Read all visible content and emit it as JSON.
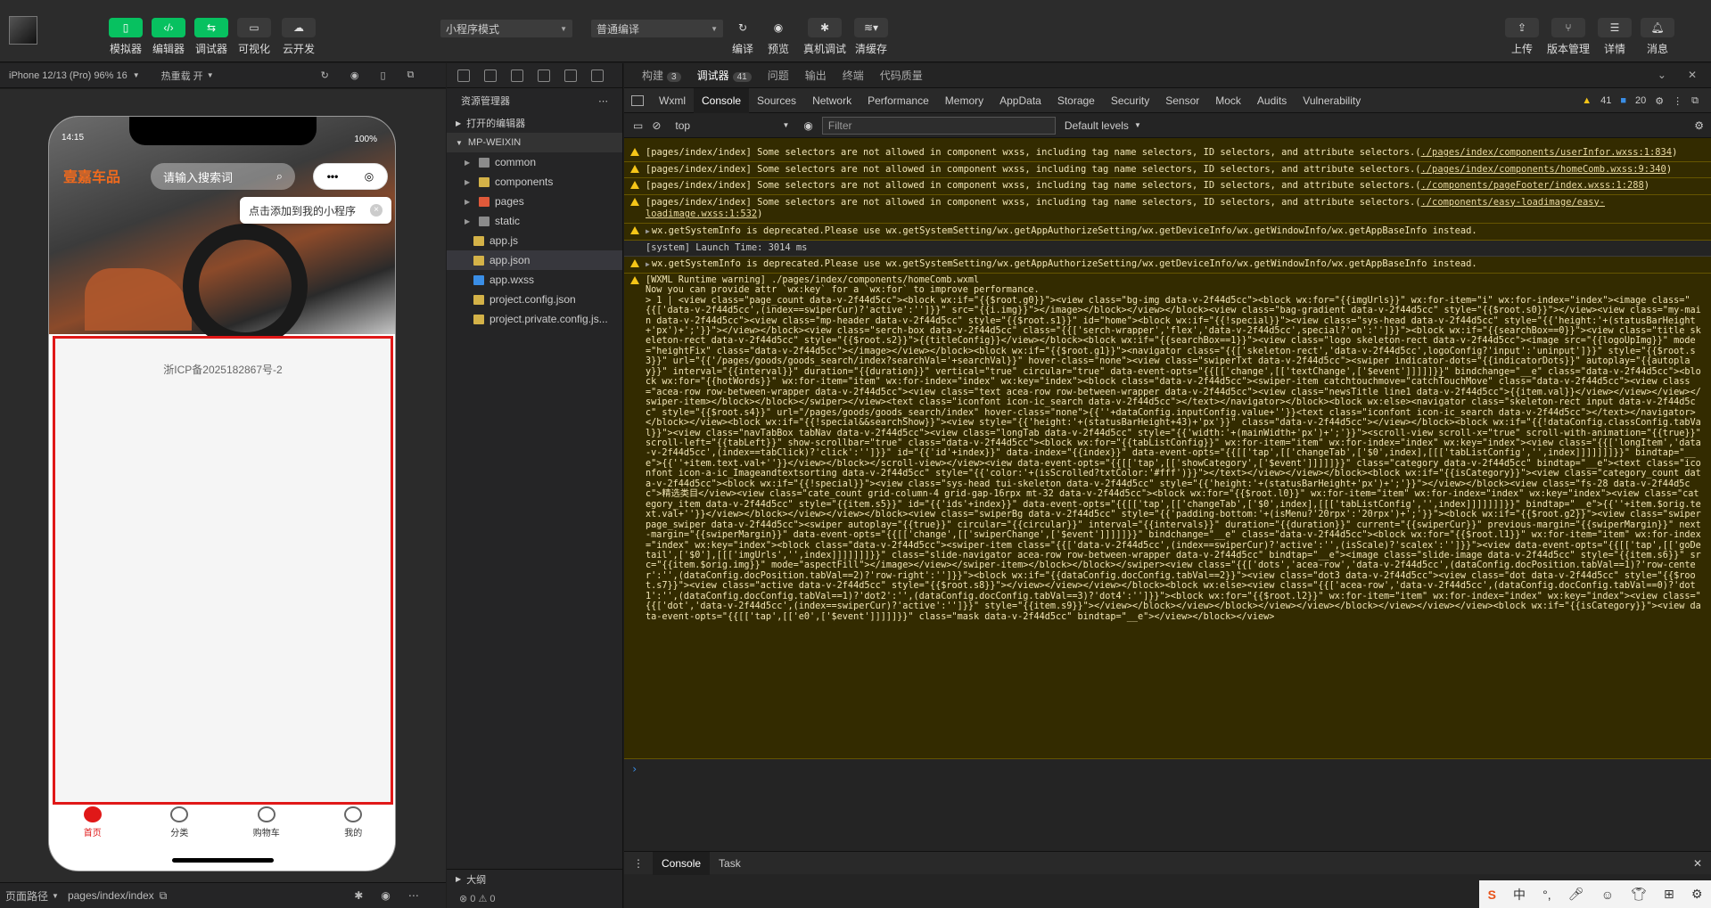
{
  "toolbar": {
    "left_buttons": [
      "模拟器",
      "编辑器",
      "调试器",
      "可视化",
      "云开发"
    ],
    "mode_select": "小程序模式",
    "compile_select": "普通编译",
    "mid_buttons": [
      "编译",
      "预览",
      "真机调试",
      "清缓存"
    ],
    "right_buttons": [
      "上传",
      "版本管理",
      "详情",
      "消息"
    ]
  },
  "simulator": {
    "device": "iPhone 12/13 (Pro) 96% 16",
    "hot_reload": "热重载 开",
    "phone": {
      "time": "14:15",
      "battery": "100%",
      "brand": "壹嘉车品",
      "search_placeholder": "请输入搜索词",
      "tip": "点击添加到我的小程序",
      "icp": "浙ICP备2025182867号-2",
      "tabs": [
        "首页",
        "分类",
        "购物车",
        "我的"
      ]
    },
    "footer": {
      "path_label": "页面路径",
      "path": "pages/index/index"
    }
  },
  "explorer": {
    "title": "资源管理器",
    "open_editors": "打开的编辑器",
    "project": "MP-WEIXIN",
    "items": [
      {
        "name": "common",
        "type": "folder",
        "color": "#8b8b8b"
      },
      {
        "name": "components",
        "type": "folder",
        "color": "#d4b248"
      },
      {
        "name": "pages",
        "type": "folder",
        "color": "#e0593a"
      },
      {
        "name": "static",
        "type": "folder",
        "color": "#8b8b8b"
      },
      {
        "name": "app.js",
        "type": "file",
        "color": "#d4b248"
      },
      {
        "name": "app.json",
        "type": "file",
        "color": "#d4b248"
      },
      {
        "name": "app.wxss",
        "type": "file",
        "color": "#3a8ee6"
      },
      {
        "name": "project.config.json",
        "type": "file",
        "color": "#d4b248"
      },
      {
        "name": "project.private.config.js...",
        "type": "file",
        "color": "#d4b248"
      }
    ],
    "outline": "大纲",
    "status": "⊗ 0 ⚠ 0"
  },
  "devtools": {
    "top_tabs": [
      {
        "label": "构建",
        "badge": "3"
      },
      {
        "label": "调试器",
        "badge": "41"
      },
      {
        "label": "问题",
        "badge": ""
      },
      {
        "label": "输出",
        "badge": ""
      },
      {
        "label": "终端",
        "badge": ""
      },
      {
        "label": "代码质量",
        "badge": ""
      }
    ],
    "panel_tabs": [
      "Wxml",
      "Console",
      "Sources",
      "Network",
      "Performance",
      "Memory",
      "AppData",
      "Storage",
      "Security",
      "Sensor",
      "Mock",
      "Audits",
      "Vulnerability"
    ],
    "warn_count": "41",
    "issue_count": "20",
    "context": "top",
    "filter_placeholder": "Filter",
    "levels": "Default levels",
    "messages": [
      {
        "type": "warn",
        "text": "[pages/index/index] Some selectors are not allowed in component wxss, including tag name selectors, ID selectors, and attribute selectors.(",
        "link": "./pages/index/components/userInfor.wxss:1:834",
        "tail": ")"
      },
      {
        "type": "warn",
        "text": "[pages/index/index] Some selectors are not allowed in component wxss, including tag name selectors, ID selectors, and attribute selectors.(",
        "link": "./pages/index/components/homeComb.wxss:9:340",
        "tail": ")"
      },
      {
        "type": "warn",
        "text": "[pages/index/index] Some selectors are not allowed in component wxss, including tag name selectors, ID selectors, and attribute selectors.(",
        "link": "./components/pageFooter/index.wxss:1:288",
        "tail": ")"
      },
      {
        "type": "warn",
        "text": "[pages/index/index] Some selectors are not allowed in component wxss, including tag name selectors, ID selectors, and attribute selectors.(",
        "link": "./components/easy-loadimage/easy-loadimage.wxss:1:532",
        "tail": ")"
      },
      {
        "type": "warn",
        "text": "wx.getSystemInfo is deprecated.Please use wx.getSystemSetting/wx.getAppAuthorizeSetting/wx.getDeviceInfo/wx.getWindowInfo/wx.getAppBaseInfo instead.",
        "link": "",
        "tail": ""
      },
      {
        "type": "info",
        "text": "[system] Launch Time: 3014 ms",
        "link": "",
        "tail": ""
      },
      {
        "type": "warn",
        "text": "wx.getSystemInfo is deprecated.Please use wx.getSystemSetting/wx.getAppAuthorizeSetting/wx.getDeviceInfo/wx.getWindowInfo/wx.getAppBaseInfo instead.",
        "link": "",
        "tail": ""
      }
    ],
    "runtime_warning": {
      "title": "[WXML Runtime warning] ./pages/index/components/homeComb.wxml",
      "subtitle": " Now you can provide attr `wx:key` for a `wx:for` to improve performance.",
      "code": "> 1 | <view class=\"page_count data-v-2f44d5cc\"><block wx:if=\"{{$root.g0}}\"><view class=\"bg-img data-v-2f44d5cc\"><block wx:for=\"{{imgUrls}}\" wx:for-item=\"i\" wx:for-index=\"index\"><image class=\"{{['data-v-2f44d5cc',(index==swiperCur)?'active':'']}}\" src=\"{{i.img}}\"></image></block></view></block><view class=\"bag-gradient data-v-2f44d5cc\" style=\"{{$root.s0}}\"></view><view class=\"my-main data-v-2f44d5cc\"><view class=\"mp-header data-v-2f44d5cc\" style=\"{{$root.s1}}\" id=\"home\"><block wx:if=\"{{!special}}\"><view class=\"sys-head data-v-2f44d5cc\" style=\"{{'height:'+(statusBarHeight+'px')+';'}}\"></view></block><view class=\"serch-box data-v-2f44d5cc\" class=\"{{['serch-wrapper','flex','data-v-2f44d5cc',special?'on':'']}}\"><block wx:if=\"{{searchBox==0}}\"><view class=\"title skeleton-rect data-v-2f44d5cc\" style=\"{{$root.s2}}\">{{titleConfig}}</view></block><block wx:if=\"{{searchBox==1}}\"><view class=\"logo skeleton-rect data-v-2f44d5cc\"><image src=\"{{logoUpImg}}\" mode=\"heightFix\" class=\"data-v-2f44d5cc\"></image></view></block><block wx:if=\"{{$root.g1}}\"><navigator class=\"{{['skeleton-rect','data-v-2f44d5cc',logoConfig?'input':'uninput']}}\" style=\"{{$root.s3}}\" url=\"{{'/pages/goods/goods_search/index?searchVal='+searchVal}}\" hover-class=\"none\"><view class=\"swiperTxt data-v-2f44d5cc\"><swiper indicator-dots=\"{{indicatorDots}}\" autoplay=\"{{autoplay}}\" interval=\"{{interval}}\" duration=\"{{duration}}\" vertical=\"true\" circular=\"true\" data-event-opts=\"{{[['change',[['textChange',['$event']]]]]}}\" bindchange=\"__e\" class=\"data-v-2f44d5cc\"><block wx:for=\"{{hotWords}}\" wx:for-item=\"item\" wx:for-index=\"index\" wx:key=\"index\"><block class=\"data-v-2f44d5cc\"><swiper-item catchtouchmove=\"catchTouchMove\" class=\"data-v-2f44d5cc\"><view class=\"acea-row row-between-wrapper data-v-2f44d5cc\"><view class=\"text acea-row row-between-wrapper data-v-2f44d5cc\"><view class=\"newsTitle line1 data-v-2f44d5cc\">{{item.val}}</view></view></view></swiper-item></block></block></swiper></view><text class=\"iconfont icon-ic_search data-v-2f44d5cc\"></text></navigator></block><block wx:else><navigator class=\"skeleton-rect input data-v-2f44d5cc\" style=\"{{$root.s4}}\" url=\"/pages/goods/goods_search/index\" hover-class=\"none\">{{''+dataConfig.inputConfig.value+''}}<text class=\"iconfont icon-ic_search data-v-2f44d5cc\"></text></navigator></block></view><block wx:if=\"{{!special&&searchShow}}\"><view style=\"{{'height:'+(statusBarHeight+43)+'px'}}\" class=\"data-v-2f44d5cc\"></view></block><block wx:if=\"{{!dataConfig.classConfig.tabVal}}\"><view class=\"navTabBox tabNav data-v-2f44d5cc\"><view class=\"longTab data-v-2f44d5cc\" style=\"{{'width:'+(mainWidth+'px')+';'}}\"><scroll-view scroll-x=\"true\" scroll-with-animation=\"{{true}}\" scroll-left=\"{{tabLeft}}\" show-scrollbar=\"true\" class=\"data-v-2f44d5cc\"><block wx:for=\"{{tabListConfig}}\" wx:for-item=\"item\" wx:for-index=\"index\" wx:key=\"index\"><view class=\"{{['longItem','data-v-2f44d5cc',(index==tabClick)?'click':'']}}\" id=\"{{'id'+index}}\" data-index=\"{{index}}\" data-event-opts=\"{{[['tap',[['changeTab',['$0',index],[[['tabListConfig','',index]]]]]]]}}\" bindtap=\"__e\">{{''+item.text.val+''}}</view></block></scroll-view></view><view data-event-opts=\"{{[['tap',[['showCategory',['$event']]]]]}}\" class=\"category data-v-2f44d5cc\" bindtap=\"__e\"><text class=\"iconfont icon-a-ic_Imageandtextsorting data-v-2f44d5cc\" style=\"{{'color:'+(isScrolled?txtColor:'#fff')}}\"></text></view></view></block><block wx:if=\"{{isCategory}}\"><view class=\"category_count data-v-2f44d5cc\"><block wx:if=\"{{!special}}\"><view class=\"sys-head tui-skeleton data-v-2f44d5cc\" style=\"{{'height:'+(statusBarHeight+'px')+';'}}\"></view></block><view class=\"fs-28 data-v-2f44d5cc\">精选类目</view><view class=\"cate_count grid-column-4 grid-gap-16rpx mt-32 data-v-2f44d5cc\"><block wx:for=\"{{$root.l0}}\" wx:for-item=\"item\" wx:for-index=\"index\" wx:key=\"index\"><view class=\"category_item data-v-2f44d5cc\" style=\"{{item.s5}}\" id=\"{{'ids'+index}}\" data-event-opts=\"{{[['tap',[['changeTab',['$0',index],[[['tabListConfig','',index]]]]]]]}}\" bindtap=\"__e\">{{''+item.$orig.text.val+''}}</view></block></view></view></block><view class=\"swiperBg data-v-2f44d5cc\" style=\"{{'padding-bottom:'+(isMenu?'20rpx':'20rpx')+';'}}\"><block wx:if=\"{{$root.g2}}\"><view class=\"swiper page_swiper data-v-2f44d5cc\"><swiper autoplay=\"{{true}}\" circular=\"{{circular}}\" interval=\"{{intervals}}\" duration=\"{{duration}}\" current=\"{{swiperCur}}\" previous-margin=\"{{swiperMargin}}\" next-margin=\"{{swiperMargin}}\" data-event-opts=\"{{[['change',[['swiperChange',['$event']]]]]}}\" bindchange=\"__e\" class=\"data-v-2f44d5cc\"><block wx:for=\"{{$root.l1}}\" wx:for-item=\"item\" wx:for-index=\"index\" wx:key=\"index\"><block class=\"data-v-2f44d5cc\"><swiper-item class=\"{{['data-v-2f44d5cc',(index==swiperCur)?'active':'',(isScale)?'scalex':'']}}\"><view data-event-opts=\"{{[['tap',[['goDetail',['$0'],[[['imgUrls','',index]]]]]]]}}\" class=\"slide-navigator acea-row row-between-wrapper data-v-2f44d5cc\" bindtap=\"__e\"><image class=\"slide-image data-v-2f44d5cc\" style=\"{{item.s6}}\" src=\"{{item.$orig.img}}\" mode=\"aspectFill\"></image></view></swiper-item></block></block></swiper><view class=\"{{['dots','acea-row','data-v-2f44d5cc',(dataConfig.docPosition.tabVal==1)?'row-center':'',(dataConfig.docPosition.tabVal==2)?'row-right':'']}}\"><block wx:if=\"{{dataConfig.docConfig.tabVal==2}}\"><view class=\"dot3 data-v-2f44d5cc\"><view class=\"dot data-v-2f44d5cc\" style=\"{{$root.s7}}\"><view class=\"active data-v-2f44d5cc\" style=\"{{$root.s8}}\"></view></view></view></block><block wx:else><view class=\"{{['acea-row','data-v-2f44d5cc',(dataConfig.docConfig.tabVal==0)?'dot1':'',(dataConfig.docConfig.tabVal==1)?'dot2':'',(dataConfig.docConfig.tabVal==3)?'dot4':'']}}\"><block wx:for=\"{{$root.l2}}\" wx:for-item=\"item\" wx:for-index=\"index\" wx:key=\"index\"><view class=\"{{['dot','data-v-2f44d5cc',(index==swiperCur)?'active':'']}}\" style=\"{{item.s9}}\"></view></block></view></block></view></view></block></view></view></view><block wx:if=\"{{isCategory}}\"><view data-event-opts=\"{{[['tap',[['e0',['$event']]]]]}}\" class=\"mask data-v-2f44d5cc\" bindtap=\"__e\"></view></block></view>"
    },
    "drawer_tabs": [
      "Console",
      "Task"
    ]
  }
}
